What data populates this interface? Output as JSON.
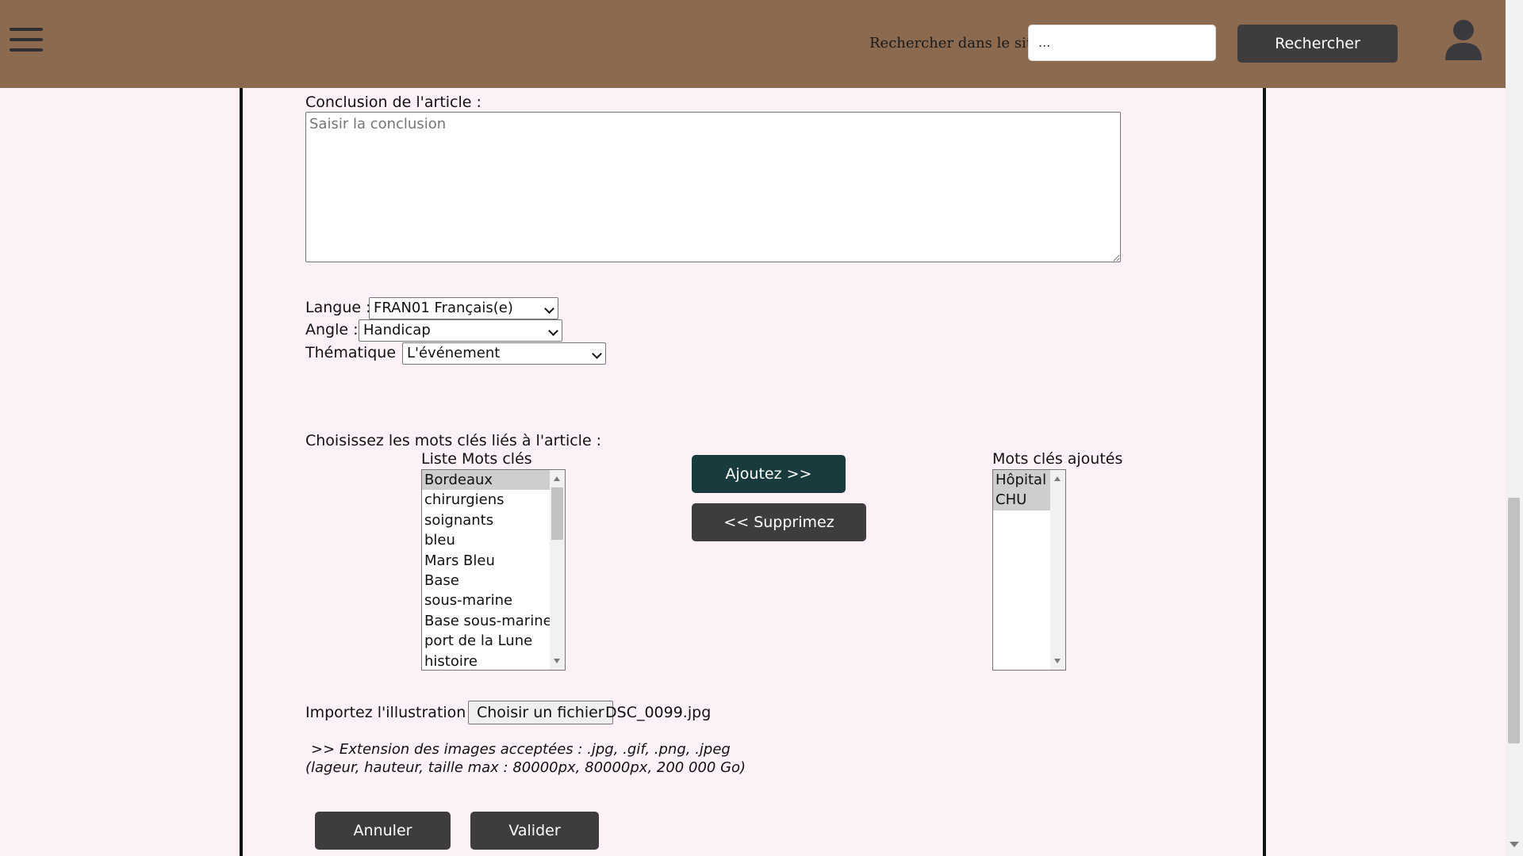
{
  "header": {
    "search_label": "Rechercher dans le site :",
    "search_value": "...",
    "search_button": "Rechercher",
    "background": "#8b6a50"
  },
  "form": {
    "conclusion": {
      "label": "Conclusion de l'article :",
      "placeholder": "Saisir la conclusion"
    },
    "langue": {
      "label": "Langue :",
      "value": "FRAN01 Français(e)"
    },
    "angle": {
      "label": "Angle :",
      "value": "Handicap"
    },
    "thematique": {
      "label": "Thématique :",
      "value": "L'événement"
    },
    "keywords": {
      "prompt": "Choisissez les mots clés liés à l'article :",
      "list_title": "Liste Mots clés",
      "list": [
        "Bordeaux",
        "chirurgiens",
        "soignants",
        "bleu",
        "Mars Bleu",
        "Base",
        "sous-marine",
        "Base sous-marine",
        "port de la Lune",
        "histoire"
      ],
      "list_selected": "Bordeaux",
      "add_button": "Ajoutez >>",
      "remove_button": "<< Supprimez",
      "added_title": "Mots clés ajoutés",
      "added": [
        "Hôpital",
        "CHU"
      ]
    },
    "illustration": {
      "label": "Importez l'illustration :",
      "choose_button": "Choisir un fichier",
      "filename": "DSC_0099.jpg",
      "hint_line1": ">> Extension des images acceptées : .jpg, .gif, .png, .jpeg",
      "hint_line2": "(lageur, hauteur, taille max : 80000px, 80000px, 200 000 Go)"
    },
    "cancel_button": "Annuler",
    "submit_button": "Valider"
  },
  "colors": {
    "page_bg": "#fdf1f8",
    "dark_button": "#3f3c3e",
    "teal_button": "#1a3b3d"
  },
  "icons": [
    "hamburger-menu-icon",
    "user-icon"
  ]
}
